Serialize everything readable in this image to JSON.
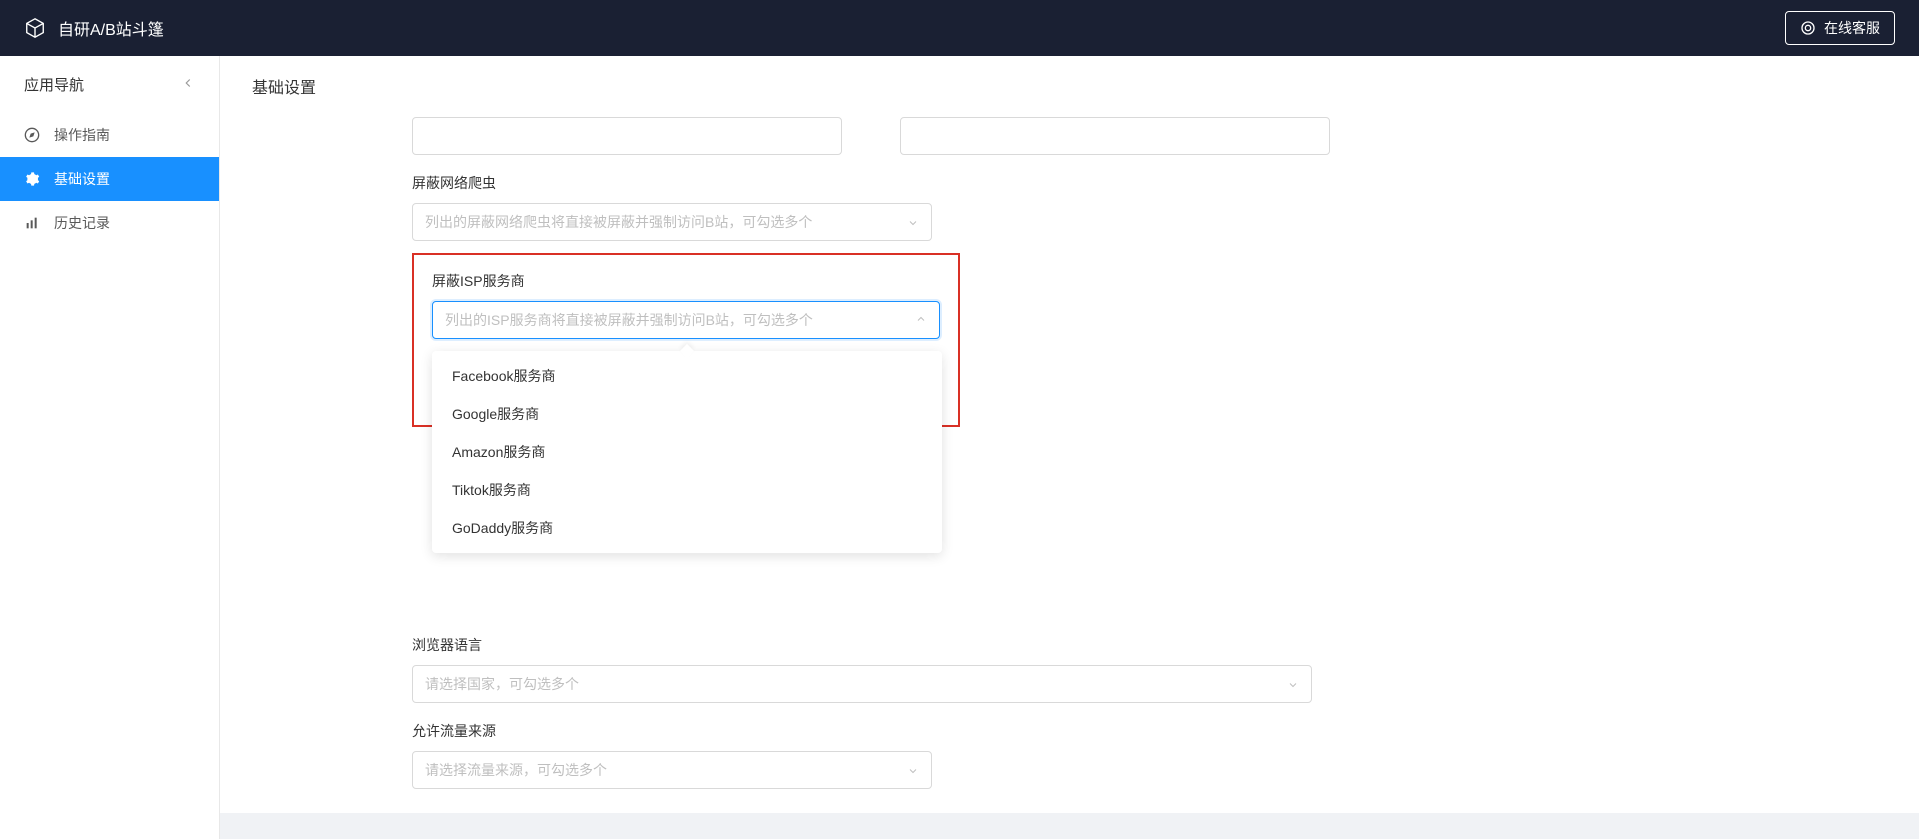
{
  "header": {
    "title": "自研A/B站斗篷",
    "customerService": "在线客服"
  },
  "sidebar": {
    "navTitle": "应用导航",
    "items": [
      {
        "label": "操作指南",
        "icon": "compass"
      },
      {
        "label": "基础设置",
        "icon": "gear"
      },
      {
        "label": "历史记录",
        "icon": "chart"
      }
    ]
  },
  "content": {
    "title": "基础设置",
    "fields": {
      "blockCrawler": {
        "label": "屏蔽网络爬虫",
        "placeholder": "列出的屏蔽网络爬虫将直接被屏蔽并强制访问B站，可勾选多个"
      },
      "blockISP": {
        "label": "屏蔽ISP服务商",
        "placeholder": "列出的ISP服务商将直接被屏蔽并强制访问B站，可勾选多个",
        "options": [
          "Facebook服务商",
          "Google服务商",
          "Amazon服务商",
          "Tiktok服务商",
          "GoDaddy服务商"
        ]
      },
      "browserLang": {
        "label": "浏览器语言",
        "placeholder": "请选择国家，可勾选多个"
      },
      "allowTraffic": {
        "label": "允许流量来源",
        "placeholder": "请选择流量来源，可勾选多个"
      }
    }
  }
}
